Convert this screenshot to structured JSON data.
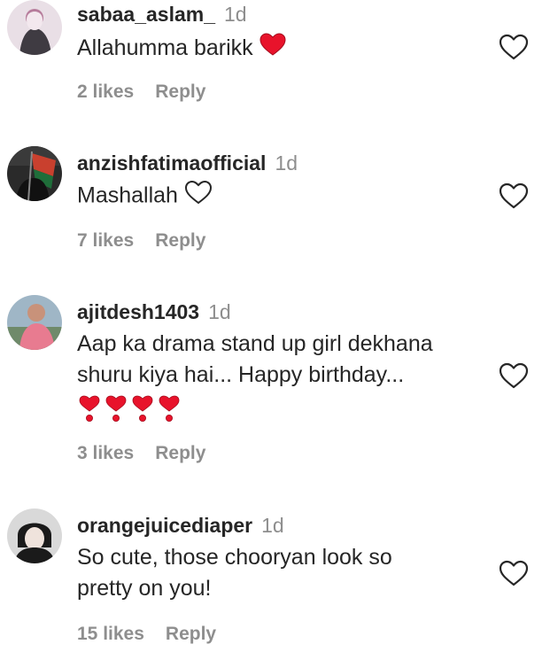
{
  "comments": [
    {
      "username": "sabaa_aslam_",
      "time": "1d",
      "text": "Allahumma barikk",
      "emoji": "red-heart",
      "likes": "2 likes",
      "reply": "Reply"
    },
    {
      "username": "anzishfatimaofficial",
      "time": "1d",
      "text": "Mashallah",
      "emoji": "white-heart",
      "likes": "7 likes",
      "reply": "Reply"
    },
    {
      "username": "ajitdesh1403",
      "time": "1d",
      "text_line1": "Aap ka drama stand up girl dekhana",
      "text_line2": "shuru kiya hai... Happy birthday...",
      "emoji": "heart-exclamation x4",
      "likes": "3 likes",
      "reply": "Reply"
    },
    {
      "username": "orangejuicediaper",
      "time": "1d",
      "text_line1": "So cute, those chooryan look so",
      "text_line2": "pretty on you!",
      "likes": "15 likes",
      "reply": "Reply"
    }
  ],
  "colors": {
    "text": "#262626",
    "muted": "#8e8e8e",
    "heart_red": "#e8132b"
  }
}
